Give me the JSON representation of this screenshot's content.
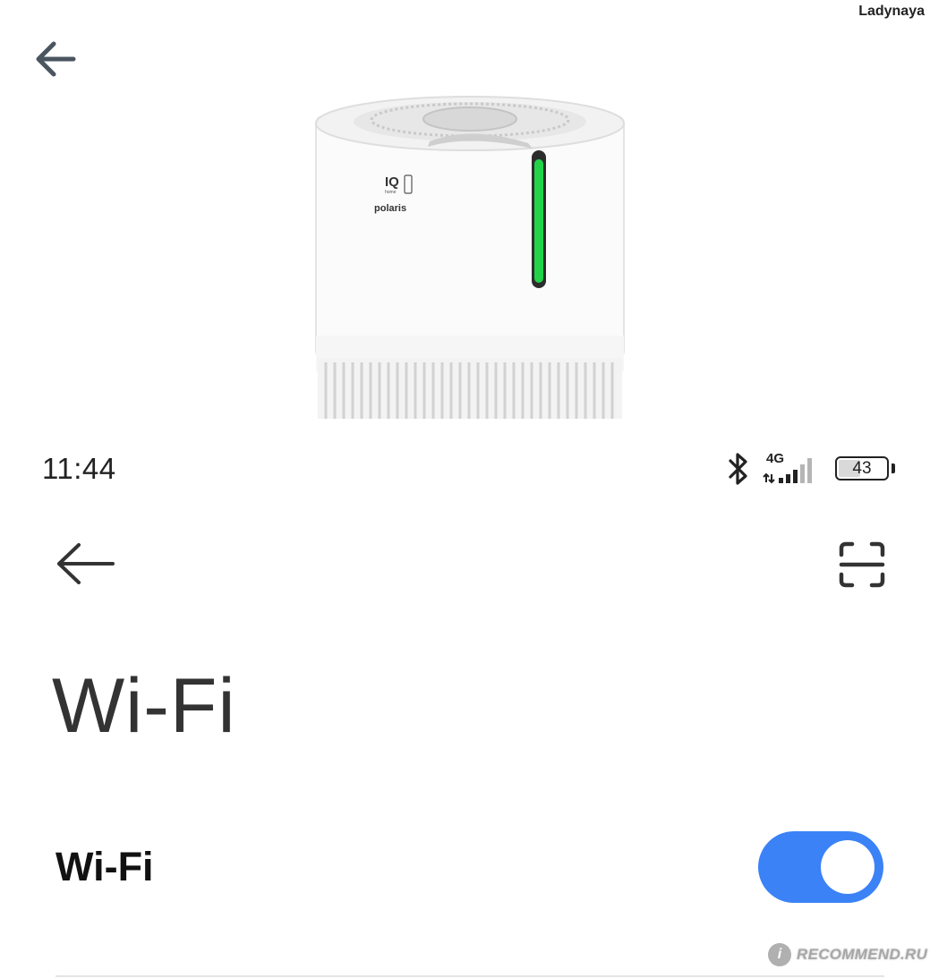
{
  "watermark": {
    "username": "Ladynaya",
    "site": "RECOMMEND.RU",
    "site_badge": "i"
  },
  "product": {
    "iq_label": "IQ",
    "iq_sub": "home",
    "brand": "polaris",
    "colors": {
      "indicator": "#22d34a"
    }
  },
  "status_bar": {
    "time": "11:44",
    "network": "4G",
    "battery": "43",
    "icons": [
      "bluetooth-icon",
      "signal-icon",
      "battery-icon"
    ]
  },
  "header": {
    "back_icon": "arrow-left-icon",
    "action_icon": "scan-icon"
  },
  "page": {
    "title": "Wi-Fi"
  },
  "settings": {
    "wifi_row": {
      "label": "Wi-Fi",
      "enabled": true
    }
  },
  "colors": {
    "toggle_on": "#3b82f6",
    "text": "#111111"
  }
}
